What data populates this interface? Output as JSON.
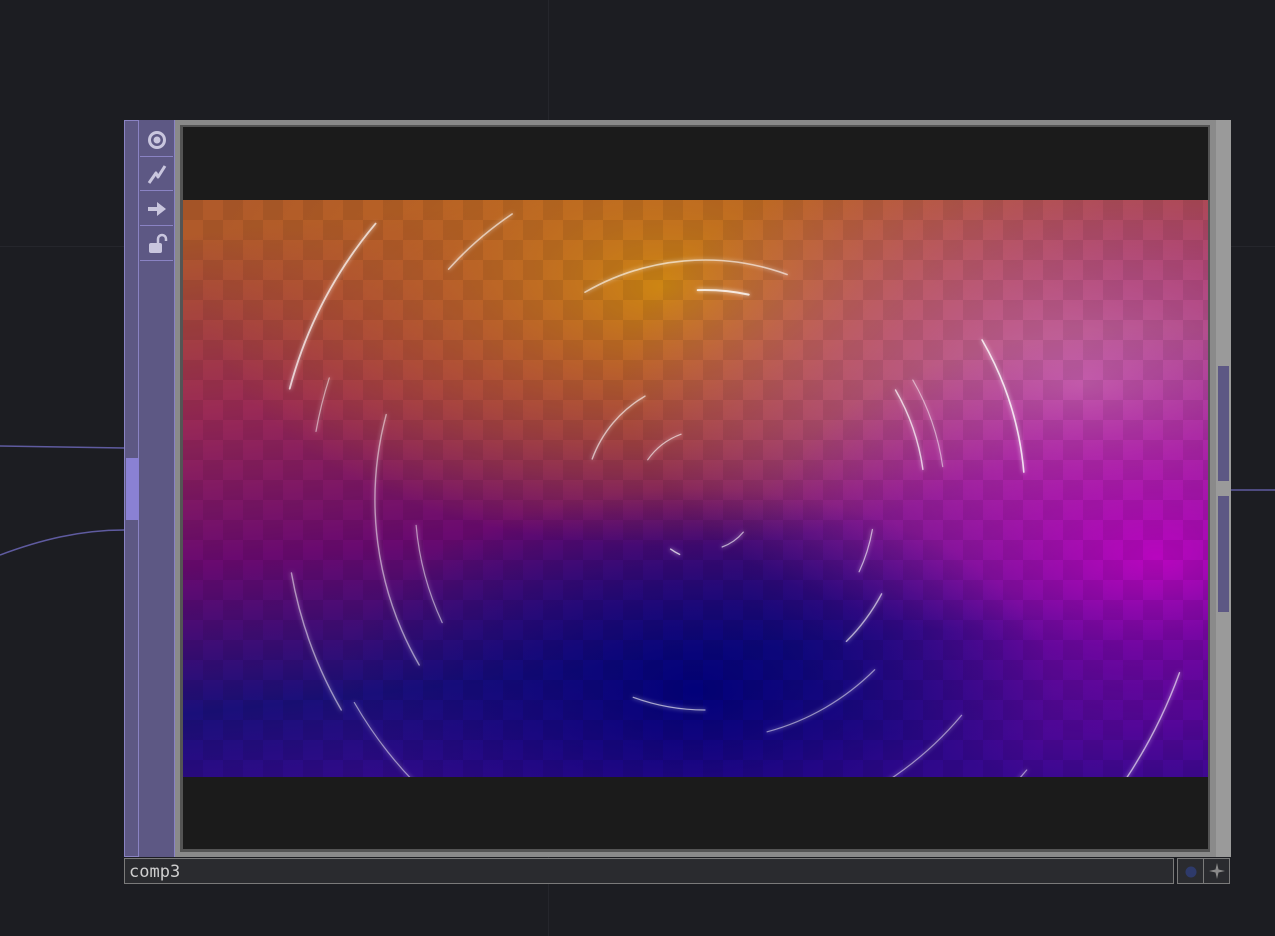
{
  "node": {
    "name": "comp3",
    "flags": [
      {
        "icon": "viewer-target-icon"
      },
      {
        "icon": "graph-icon"
      },
      {
        "icon": "arrow-right-icon"
      },
      {
        "icon": "unlock-icon"
      }
    ]
  },
  "colors": {
    "background": "#1c1d22",
    "node_purple": "#5d5884",
    "node_border": "#8a83c4",
    "wire": "#5f5ba0"
  },
  "buttons": {
    "dot_icon": "blue-dot-icon",
    "pin_icon": "pin-icon"
  }
}
